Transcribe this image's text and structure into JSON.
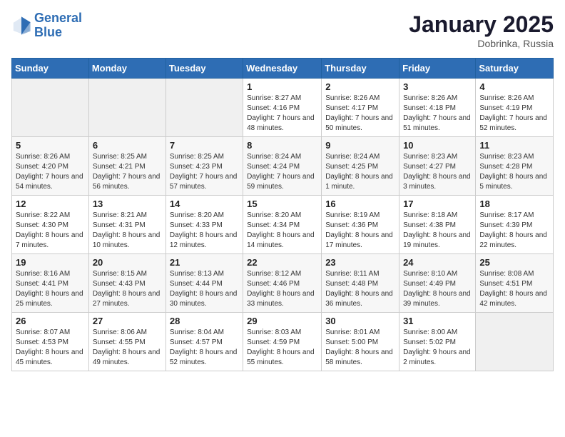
{
  "header": {
    "logo_line1": "General",
    "logo_line2": "Blue",
    "month_title": "January 2025",
    "location": "Dobrinka, Russia"
  },
  "weekdays": [
    "Sunday",
    "Monday",
    "Tuesday",
    "Wednesday",
    "Thursday",
    "Friday",
    "Saturday"
  ],
  "weeks": [
    [
      {
        "day": "",
        "info": ""
      },
      {
        "day": "",
        "info": ""
      },
      {
        "day": "",
        "info": ""
      },
      {
        "day": "1",
        "info": "Sunrise: 8:27 AM\nSunset: 4:16 PM\nDaylight: 7 hours\nand 48 minutes."
      },
      {
        "day": "2",
        "info": "Sunrise: 8:26 AM\nSunset: 4:17 PM\nDaylight: 7 hours\nand 50 minutes."
      },
      {
        "day": "3",
        "info": "Sunrise: 8:26 AM\nSunset: 4:18 PM\nDaylight: 7 hours\nand 51 minutes."
      },
      {
        "day": "4",
        "info": "Sunrise: 8:26 AM\nSunset: 4:19 PM\nDaylight: 7 hours\nand 52 minutes."
      }
    ],
    [
      {
        "day": "5",
        "info": "Sunrise: 8:26 AM\nSunset: 4:20 PM\nDaylight: 7 hours\nand 54 minutes."
      },
      {
        "day": "6",
        "info": "Sunrise: 8:25 AM\nSunset: 4:21 PM\nDaylight: 7 hours\nand 56 minutes."
      },
      {
        "day": "7",
        "info": "Sunrise: 8:25 AM\nSunset: 4:23 PM\nDaylight: 7 hours\nand 57 minutes."
      },
      {
        "day": "8",
        "info": "Sunrise: 8:24 AM\nSunset: 4:24 PM\nDaylight: 7 hours\nand 59 minutes."
      },
      {
        "day": "9",
        "info": "Sunrise: 8:24 AM\nSunset: 4:25 PM\nDaylight: 8 hours\nand 1 minute."
      },
      {
        "day": "10",
        "info": "Sunrise: 8:23 AM\nSunset: 4:27 PM\nDaylight: 8 hours\nand 3 minutes."
      },
      {
        "day": "11",
        "info": "Sunrise: 8:23 AM\nSunset: 4:28 PM\nDaylight: 8 hours\nand 5 minutes."
      }
    ],
    [
      {
        "day": "12",
        "info": "Sunrise: 8:22 AM\nSunset: 4:30 PM\nDaylight: 8 hours\nand 7 minutes."
      },
      {
        "day": "13",
        "info": "Sunrise: 8:21 AM\nSunset: 4:31 PM\nDaylight: 8 hours\nand 10 minutes."
      },
      {
        "day": "14",
        "info": "Sunrise: 8:20 AM\nSunset: 4:33 PM\nDaylight: 8 hours\nand 12 minutes."
      },
      {
        "day": "15",
        "info": "Sunrise: 8:20 AM\nSunset: 4:34 PM\nDaylight: 8 hours\nand 14 minutes."
      },
      {
        "day": "16",
        "info": "Sunrise: 8:19 AM\nSunset: 4:36 PM\nDaylight: 8 hours\nand 17 minutes."
      },
      {
        "day": "17",
        "info": "Sunrise: 8:18 AM\nSunset: 4:38 PM\nDaylight: 8 hours\nand 19 minutes."
      },
      {
        "day": "18",
        "info": "Sunrise: 8:17 AM\nSunset: 4:39 PM\nDaylight: 8 hours\nand 22 minutes."
      }
    ],
    [
      {
        "day": "19",
        "info": "Sunrise: 8:16 AM\nSunset: 4:41 PM\nDaylight: 8 hours\nand 25 minutes."
      },
      {
        "day": "20",
        "info": "Sunrise: 8:15 AM\nSunset: 4:43 PM\nDaylight: 8 hours\nand 27 minutes."
      },
      {
        "day": "21",
        "info": "Sunrise: 8:13 AM\nSunset: 4:44 PM\nDaylight: 8 hours\nand 30 minutes."
      },
      {
        "day": "22",
        "info": "Sunrise: 8:12 AM\nSunset: 4:46 PM\nDaylight: 8 hours\nand 33 minutes."
      },
      {
        "day": "23",
        "info": "Sunrise: 8:11 AM\nSunset: 4:48 PM\nDaylight: 8 hours\nand 36 minutes."
      },
      {
        "day": "24",
        "info": "Sunrise: 8:10 AM\nSunset: 4:49 PM\nDaylight: 8 hours\nand 39 minutes."
      },
      {
        "day": "25",
        "info": "Sunrise: 8:08 AM\nSunset: 4:51 PM\nDaylight: 8 hours\nand 42 minutes."
      }
    ],
    [
      {
        "day": "26",
        "info": "Sunrise: 8:07 AM\nSunset: 4:53 PM\nDaylight: 8 hours\nand 45 minutes."
      },
      {
        "day": "27",
        "info": "Sunrise: 8:06 AM\nSunset: 4:55 PM\nDaylight: 8 hours\nand 49 minutes."
      },
      {
        "day": "28",
        "info": "Sunrise: 8:04 AM\nSunset: 4:57 PM\nDaylight: 8 hours\nand 52 minutes."
      },
      {
        "day": "29",
        "info": "Sunrise: 8:03 AM\nSunset: 4:59 PM\nDaylight: 8 hours\nand 55 minutes."
      },
      {
        "day": "30",
        "info": "Sunrise: 8:01 AM\nSunset: 5:00 PM\nDaylight: 8 hours\nand 58 minutes."
      },
      {
        "day": "31",
        "info": "Sunrise: 8:00 AM\nSunset: 5:02 PM\nDaylight: 9 hours\nand 2 minutes."
      },
      {
        "day": "",
        "info": ""
      }
    ]
  ]
}
